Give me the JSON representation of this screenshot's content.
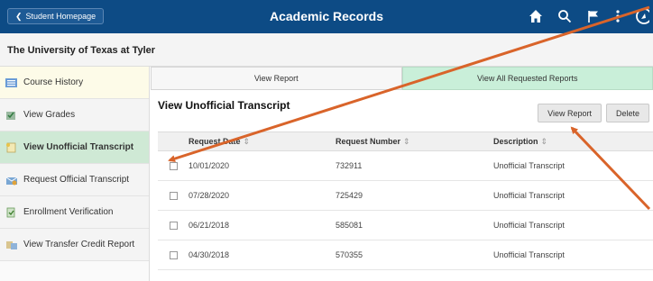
{
  "header": {
    "home_button": "Student Homepage",
    "title": "Academic Records",
    "icons": [
      "home-icon",
      "search-icon",
      "flag-icon",
      "more-icon",
      "navbar-icon"
    ],
    "bg_color": "#0d4b85"
  },
  "institution": {
    "name": "The University of Texas at Tyler"
  },
  "sidebar": {
    "items": [
      {
        "label": "Course History",
        "icon": "course-history-icon"
      },
      {
        "label": "View Grades",
        "icon": "grades-icon"
      },
      {
        "label": "View Unofficial Transcript",
        "icon": "transcript-icon",
        "active": true
      },
      {
        "label": "Request Official Transcript",
        "icon": "request-icon"
      },
      {
        "label": "Enrollment Verification",
        "icon": "verification-icon"
      },
      {
        "label": "View Transfer Credit Report",
        "icon": "transfer-icon"
      }
    ],
    "active_color": "#cfe9d5"
  },
  "main": {
    "tabs": [
      {
        "label": "View Report"
      },
      {
        "label": "View All Requested Reports",
        "active": true
      }
    ],
    "page_title": "View Unofficial Transcript",
    "buttons": {
      "view_report": "View Report",
      "delete": "Delete"
    },
    "table": {
      "headers": {
        "date": "Request Date",
        "number": "Request Number",
        "description": "Description"
      },
      "rows": [
        {
          "date": "10/01/2020",
          "number": "732911",
          "description": "Unofficial Transcript"
        },
        {
          "date": "07/28/2020",
          "number": "725429",
          "description": "Unofficial Transcript"
        },
        {
          "date": "06/21/2018",
          "number": "585081",
          "description": "Unofficial Transcript"
        },
        {
          "date": "04/30/2018",
          "number": "570355",
          "description": "Unofficial Transcript"
        }
      ]
    }
  },
  "annotation_color": "#d9642a"
}
